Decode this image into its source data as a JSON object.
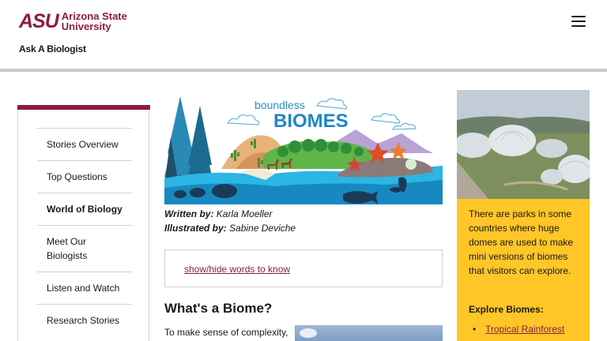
{
  "header": {
    "logo_mark": "ASU",
    "logo_line1": "Arizona State",
    "logo_line2": "University",
    "site_title": "Ask A Biologist",
    "menu_icon": "hamburger-menu-icon"
  },
  "sidebar": {
    "items": [
      {
        "label": "Stories Overview"
      },
      {
        "label": "Top Questions"
      },
      {
        "label": "World of Biology"
      },
      {
        "label": "Meet Our Biologists"
      },
      {
        "label": "Listen and Watch"
      },
      {
        "label": "Research Stories"
      }
    ],
    "active_index": 2
  },
  "main": {
    "banner_title_small": "boundless",
    "banner_title_big": "BIOMES",
    "written_by_label": "Written by:",
    "written_by": "Karla Moeller",
    "illustrated_by_label": "Illustrated by:",
    "illustrated_by": "Sabine Deviche",
    "words_link": "show/hide words to know",
    "heading": "What's a Biome?",
    "intro": "To make sense of complexity,"
  },
  "aside": {
    "text": "There are parks in some countries where huge domes are used to make mini versions of biomes that visitors can explore.",
    "heading": "Explore Biomes:",
    "links": [
      "Tropical Rainforest"
    ]
  },
  "colors": {
    "maroon": "#8c1d40",
    "gold": "#ffc627",
    "rule": "#c8c9c9"
  }
}
